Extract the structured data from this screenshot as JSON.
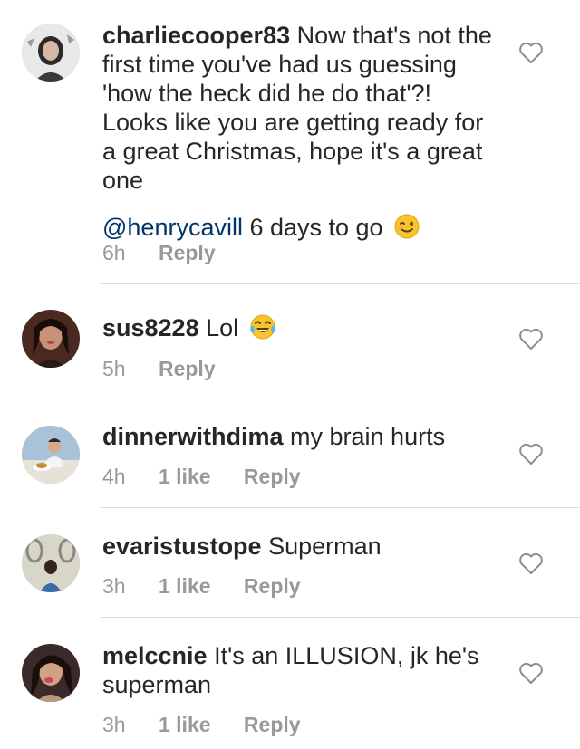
{
  "comments": [
    {
      "username": "charliecooper83",
      "text": " Now that's not the first time you've had us guessing 'how the heck did he do that'?! Looks like you are getting ready for a great Christmas, hope it's a great one",
      "mention": "@henrycavill",
      "text_after": " 6 days to go",
      "emoji": "winking-face-emoji",
      "time": "6h",
      "likes": "",
      "reply": "Reply"
    },
    {
      "username": "sus8228",
      "text": " Lol",
      "emoji": "tears-of-joy-emoji",
      "time": "5h",
      "likes": "",
      "reply": "Reply"
    },
    {
      "username": "dinnerwithdima",
      "text": " my brain hurts",
      "time": "4h",
      "likes": "1 like",
      "reply": "Reply"
    },
    {
      "username": "evaristustope",
      "text": " Superman",
      "time": "3h",
      "likes": "1 like",
      "reply": "Reply"
    },
    {
      "username": "melccnie",
      "text": " It's an ILLUSION, jk he's superman",
      "time": "3h",
      "likes": "1 like",
      "reply": "Reply"
    }
  ],
  "colors": {
    "text": "#262626",
    "meta": "#999999",
    "mention": "#003569",
    "divider": "#dbdbdb"
  }
}
